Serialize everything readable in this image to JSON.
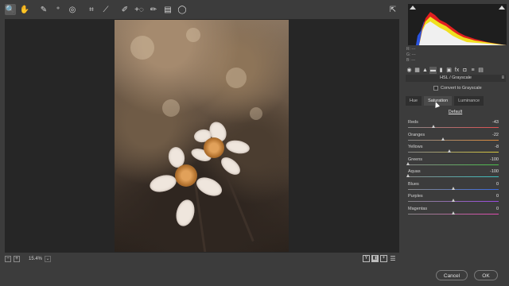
{
  "toolbar": {
    "tools": [
      {
        "icon": "zoom-icon",
        "glyph": "🔍",
        "active": true
      },
      {
        "icon": "hand-icon",
        "glyph": "✋"
      },
      {
        "icon": "white-balance-icon",
        "glyph": "✎",
        "sep": true
      },
      {
        "icon": "color-sampler-icon",
        "glyph": "⁺"
      },
      {
        "icon": "targeted-adjustment-icon",
        "glyph": "◎"
      },
      {
        "icon": "crop-icon",
        "glyph": "⌗",
        "sep": true
      },
      {
        "icon": "straighten-icon",
        "glyph": "⟋"
      },
      {
        "icon": "spot-removal-icon",
        "glyph": "✐",
        "sep": true
      },
      {
        "icon": "red-eye-icon",
        "glyph": "+◌"
      },
      {
        "icon": "adjustment-brush-icon",
        "glyph": "✏"
      },
      {
        "icon": "graduated-filter-icon",
        "glyph": "▤"
      },
      {
        "icon": "radial-filter-icon",
        "glyph": "◯"
      }
    ],
    "export_icon": "export-icon"
  },
  "bottom_bar": {
    "zoom_out_glyph": "−",
    "zoom_in_glyph": "+",
    "zoom_value": "15.4%",
    "zoom_dropdown_glyph": "⌄",
    "view_buttons": [
      {
        "icon": "before-after-y-icon",
        "glyph": "Y"
      },
      {
        "icon": "before-after-split-icon",
        "glyph": "◧",
        "solid": true
      },
      {
        "icon": "before-after-toggle-icon",
        "glyph": "+"
      }
    ],
    "settings_icon": "☰"
  },
  "histogram": {
    "colors": {
      "red": "#e02020",
      "yellow": "#f0e020",
      "blue": "#2a54e0",
      "white": "#f0f0f0"
    }
  },
  "rgb_readout": {
    "r_label": "R:",
    "g_label": "G:",
    "b_label": "B:",
    "r_val": "---",
    "g_val": "---",
    "b_val": "---"
  },
  "panel_icons": [
    {
      "icon": "basic-icon",
      "glyph": "◉",
      "active": true
    },
    {
      "icon": "tone-curve-icon",
      "glyph": "▦"
    },
    {
      "icon": "detail-icon",
      "glyph": "▲"
    },
    {
      "icon": "hsl-icon",
      "glyph": "▬",
      "active": true
    },
    {
      "icon": "split-toning-icon",
      "glyph": "▮"
    },
    {
      "icon": "lens-icon",
      "glyph": "▣"
    },
    {
      "icon": "effects-icon",
      "glyph": "fx"
    },
    {
      "icon": "camera-calibration-icon",
      "glyph": "◘"
    },
    {
      "icon": "presets-icon",
      "glyph": "≡"
    },
    {
      "icon": "snapshots-icon",
      "glyph": "▤"
    }
  ],
  "hsl": {
    "header": "HSL / Grayscale",
    "menu_glyph": "≡",
    "convert_label": "Convert to Grayscale",
    "tabs": [
      "Hue",
      "Saturation",
      "Luminance"
    ],
    "active_tab": 1,
    "default_label": "Default",
    "sliders": [
      {
        "label": "Reds",
        "value": "-43",
        "num": -43,
        "track": "linear-gradient(90deg,#888 0%,#e05050 100%)"
      },
      {
        "label": "Oranges",
        "value": "-22",
        "num": -22,
        "track": "linear-gradient(90deg,#888 0%,#e08a3a 100%)"
      },
      {
        "label": "Yellows",
        "value": "-8",
        "num": -8,
        "track": "linear-gradient(90deg,#888 0%,#d8c83a 100%)"
      },
      {
        "label": "Greens",
        "value": "-100",
        "num": -100,
        "track": "linear-gradient(90deg,#888 0%,#4ac04a 100%)"
      },
      {
        "label": "Aquas",
        "value": "-100",
        "num": -100,
        "track": "linear-gradient(90deg,#888 0%,#3ac0c0 100%)"
      },
      {
        "label": "Blues",
        "value": "0",
        "num": 0,
        "track": "linear-gradient(90deg,#888 0%,#3a6ae0 100%)"
      },
      {
        "label": "Purples",
        "value": "0",
        "num": 0,
        "track": "linear-gradient(90deg,#888 0%,#9a4ae0 100%)"
      },
      {
        "label": "Magentas",
        "value": "0",
        "num": 0,
        "track": "linear-gradient(90deg,#888 0%,#e04ab0 100%)"
      }
    ]
  },
  "footer": {
    "cancel_label": "Cancel",
    "ok_label": "OK"
  }
}
